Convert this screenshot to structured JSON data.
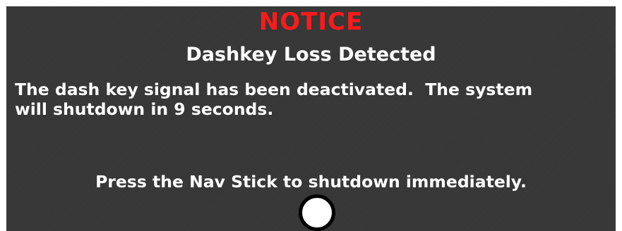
{
  "dialog": {
    "notice_label": "NOTICE",
    "title": "Dashkey Loss Detected",
    "message_line1": "The dash key signal has been deactivated.  The system",
    "message_line2": "will shutdown in 9 seconds.",
    "prompt": "Press the Nav Stick to shutdown immediately."
  },
  "colors": {
    "background": "#363636",
    "notice": "#ff1a1a",
    "text": "#ffffff",
    "button_fill": "#ffffff",
    "button_border": "#000000"
  },
  "icons": {
    "nav_button": "nav-stick-button-icon"
  }
}
